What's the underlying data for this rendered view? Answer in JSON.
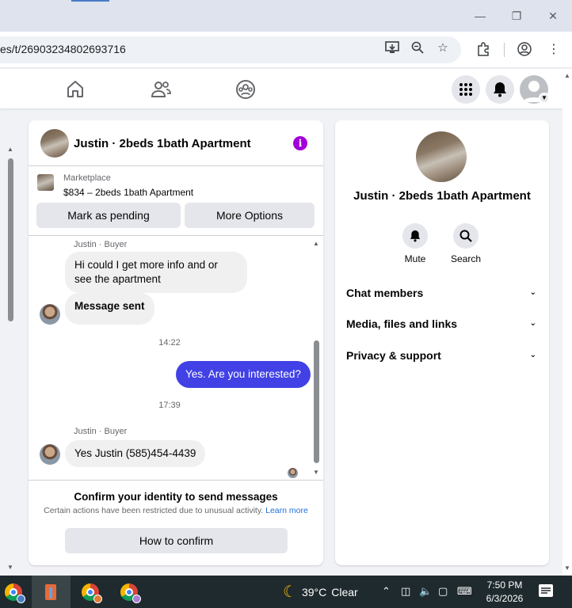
{
  "browser": {
    "url": "es/t/26903234802693716",
    "window_controls": {
      "minimize_icon": "minimize-icon",
      "restore_icon": "restore-icon",
      "close_icon": "close-icon"
    }
  },
  "chat": {
    "title": "Justin · 2beds 1bath Apartment",
    "marketplace_label": "Marketplace",
    "listing": "$834 – 2beds 1bath Apartment",
    "mark_pending_label": "Mark as pending",
    "more_options_label": "More Options",
    "messages": [
      {
        "sender": "Justin · Buyer",
        "text": "Hi could I get more info and or see the apartment"
      },
      {
        "text": "Message sent"
      },
      {
        "timestamp": "14:22"
      },
      {
        "text": "Yes. Are you interested?",
        "mine": true
      },
      {
        "timestamp": "17:39"
      },
      {
        "sender": "Justin · Buyer",
        "text": "Yes Justin (585)454-4439"
      }
    ],
    "confirm_title": "Confirm your identity to send messages",
    "confirm_sub": "Certain actions have been restricted due to unusual activity.",
    "learn_more": "Learn more",
    "how_to_confirm": "How to confirm"
  },
  "info_panel": {
    "title": "Justin · 2beds 1bath Apartment",
    "mute_label": "Mute",
    "search_label": "Search",
    "sections": [
      "Chat members",
      "Media, files and links",
      "Privacy & support"
    ]
  },
  "taskbar": {
    "temperature": "39°C",
    "weather": "Clear",
    "time": "7:50 PM",
    "date": "6/3/2026"
  },
  "colors": {
    "accent": "#4141e6",
    "info_icon": "#a200d6",
    "link": "#216fdb"
  }
}
